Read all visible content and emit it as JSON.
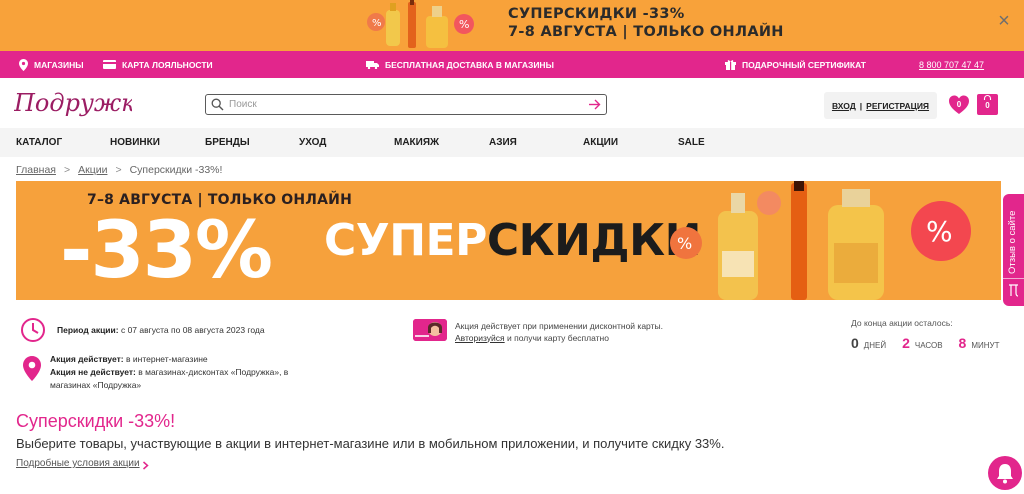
{
  "promo": {
    "line1": "СУПЕРСКИДКИ -33%",
    "line2": "7-8 АВГУСТА | ТОЛЬКО ОНЛАЙН",
    "close_label": "×"
  },
  "infobar": {
    "stores": "МАГАЗИНЫ",
    "loyalty": "КАРТА ЛОЯЛЬНОСТИ",
    "delivery": "БЕСПЛАТНАЯ ДОСТАВКА В МАГАЗИНЫ",
    "gift": "ПОДАРОЧНЫЙ СЕРТИФИКАТ",
    "phone": "8 800 707 47 47"
  },
  "header": {
    "search_placeholder": "Поиск",
    "login": "ВХОД",
    "separator": "|",
    "register": "РЕГИСТРАЦИЯ",
    "favorites_count": "0",
    "cart_count": "0"
  },
  "logo_text": "Подружка",
  "nav": [
    "КАТАЛОГ",
    "НОВИНКИ",
    "БРЕНДЫ",
    "УХОД",
    "МАКИЯЖ",
    "АЗИЯ",
    "АКЦИИ",
    "SALE"
  ],
  "breadcrumb": {
    "home": "Главная",
    "sep": ">",
    "promos": "Акции",
    "current": "Суперскидки -33%!"
  },
  "banner": {
    "date": "7–8 АВГУСТА | ТОЛЬКО ОНЛАЙН",
    "percent": "-33%",
    "super": "СУПЕР",
    "sales": "СКИДКИ"
  },
  "feedback": "Отзыв о сайте",
  "info": {
    "period_label": "Период акции:",
    "period_value": " с 07 августа по 08 августа 2023 года",
    "active_label": "Акция действует:",
    "active_value": " в интернет-магазине",
    "inactive_label": "Акция не действует:",
    "inactive_value_1": " в магазинах-дисконтах «Подружка», в",
    "inactive_value_2": "магазинах «Подружка»",
    "card_line1": "Акция действует при применении дисконтной карты.",
    "card_link": "Авторизуйся",
    "card_line2": " и получи карту бесплатно"
  },
  "timer": {
    "title": "До конца акции осталось:",
    "days": "0",
    "days_label": "ДНЕЙ",
    "hours": "2",
    "hours_label": "ЧАСОВ",
    "minutes": "8",
    "minutes_label": "МИНУТ"
  },
  "content": {
    "title": "Суперскидки -33%!",
    "description": "Выберите товары, участвующие в акции в интернет-магазине или в мобильном приложении, и получите скидку 33%.",
    "terms_link": "Подробные условия акции"
  },
  "colors": {
    "brand": "#e2268c",
    "promo_orange": "#f8a23a"
  }
}
